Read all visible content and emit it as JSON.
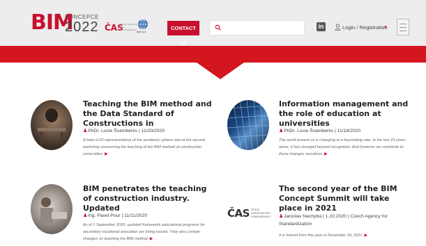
{
  "header": {
    "logo_bim": "BIM",
    "logo_koncepce": "KONCEPCE",
    "logo_year": "2022",
    "partner_cas": "ČAS",
    "partner_cas_text": "ČESKÁ AGENTURA PRO STANDARDIZACI",
    "partner_globe_text": "BENTLEY",
    "contact_label": "CONTACT US",
    "search_placeholder": "",
    "linkedin_label": "in",
    "login_label": "Login / Registration",
    "caret": "▾"
  },
  "colors": {
    "brand_red": "#c8102e",
    "band_red": "#d4161e",
    "header_bg": "#ededed"
  },
  "articles": [
    {
      "title": "Teaching the BIM method and the Data Standard of Constructions in",
      "author": "PhDr. Lucie Švamberks",
      "date": "11/20/2020",
      "excerpt": "A total of 22 representatives of the academic sphere met at the second workshop concerning the teaching of the BIM method at construction universities."
    },
    {
      "title": "Information management and the role of education at universities",
      "author": "PhDr. Lucie Švamberks",
      "date": "11/18/2020",
      "excerpt": "The world around us is changing at a fascinating rate. In the last 25 years alone, it has changed beyond recognition. And however we contribute to these changes ourselves."
    },
    {
      "title": "BIM penetrates the teaching of construction industry. Updated",
      "author": "Ing. Pavel Pour",
      "date": "11/11/2020",
      "excerpt": "As of 1 September 2020, updated framework educational programs for secondary vocational education are being issued. They also contain changes on teaching the BIM method."
    },
    {
      "title": "The second year of the BIM Concept Summit will take place in 2021",
      "author": "Jaroslav Nechyba",
      "date": "1.10.2020",
      "source": "Czech Agency for Standardization",
      "excerpt": "It is moved from this year to November 18, 2021."
    }
  ],
  "cas_logo": {
    "mark": "ČAS",
    "text": "ČESKÁ AGENTURA PRO STANDARDIZACI"
  }
}
